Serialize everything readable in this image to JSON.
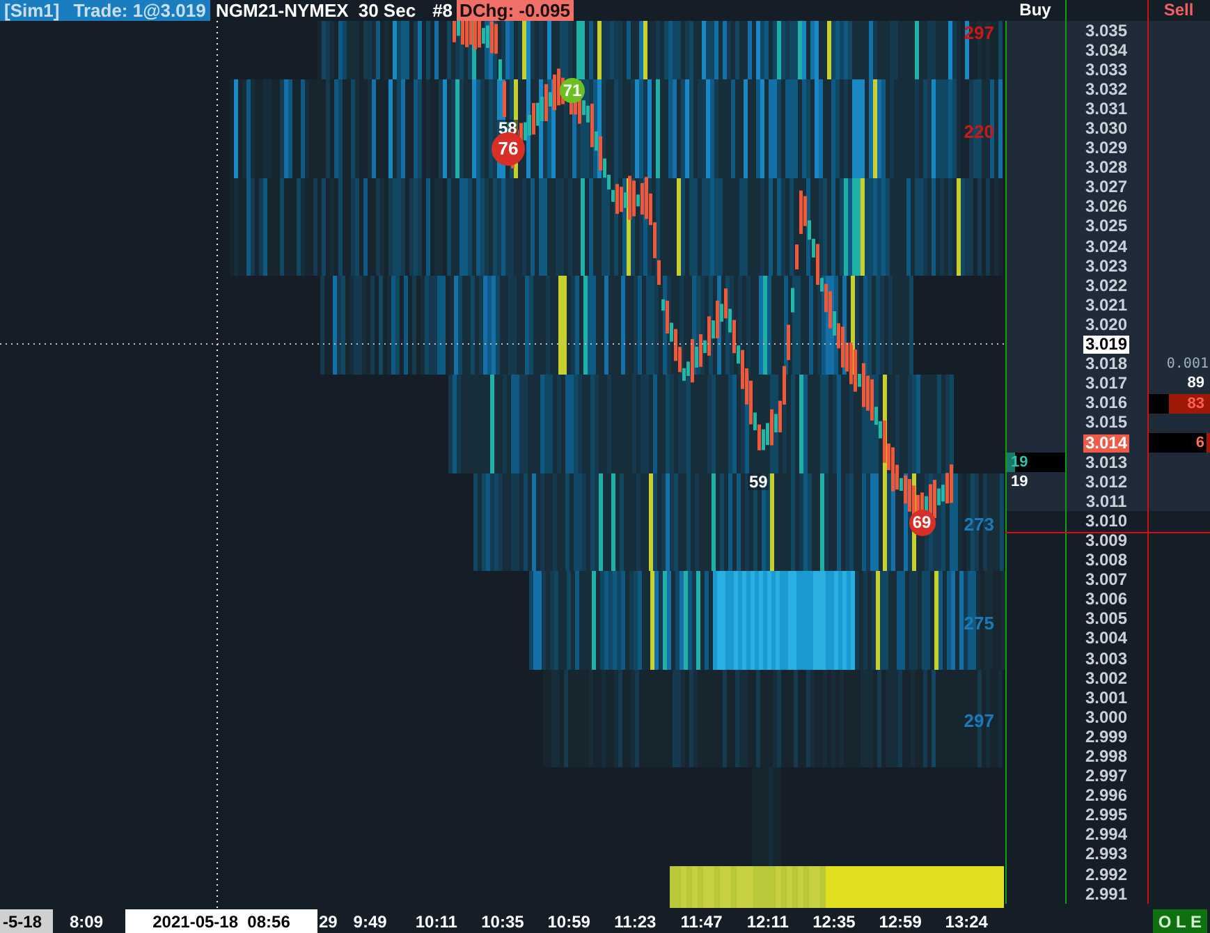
{
  "header": {
    "account": "[Sim1]",
    "trade": "Trade: 1@3.019",
    "instrument": "NGM21-NYMEX",
    "interval": "30 Sec",
    "number": "#8",
    "daily_change": "DChg: -0.095"
  },
  "chart": {
    "band_labels": [
      {
        "text": "297",
        "kind": "ask"
      },
      {
        "text": "220",
        "kind": "ask"
      },
      {
        "text": "273",
        "kind": "bid"
      },
      {
        "text": "275",
        "kind": "bid"
      },
      {
        "text": "297",
        "kind": "bid"
      }
    ],
    "bubbles": [
      {
        "text": "71",
        "kind": "buy"
      },
      {
        "text": "58",
        "kind": "label"
      },
      {
        "text": "76",
        "kind": "sell"
      },
      {
        "text": "59",
        "kind": "label"
      },
      {
        "text": "69",
        "kind": "sell"
      }
    ]
  },
  "ladder": {
    "buy_header": "Buy",
    "sell_header": "Sell",
    "rows": [
      {
        "price": "3.035"
      },
      {
        "price": "3.034"
      },
      {
        "price": "3.033"
      },
      {
        "price": "3.032"
      },
      {
        "price": "3.031"
      },
      {
        "price": "3.030"
      },
      {
        "price": "3.029"
      },
      {
        "price": "3.028"
      },
      {
        "price": "3.027"
      },
      {
        "price": "3.026"
      },
      {
        "price": "3.025"
      },
      {
        "price": "3.024"
      },
      {
        "price": "3.023"
      },
      {
        "price": "3.022"
      },
      {
        "price": "3.021"
      },
      {
        "price": "3.020"
      },
      {
        "price": "3.019",
        "current": true
      },
      {
        "price": "3.018",
        "sell": {
          "text": "0.001",
          "kind": "dim"
        }
      },
      {
        "price": "3.017",
        "sell": {
          "text": "89",
          "kind": "plain"
        }
      },
      {
        "price": "3.016",
        "sell": {
          "text": "83",
          "kind": "bar"
        }
      },
      {
        "price": "3.015"
      },
      {
        "price": "3.014",
        "last_trade": true,
        "sell": {
          "text": "6",
          "kind": "small-bar"
        }
      },
      {
        "price": "3.013",
        "buy": {
          "text": "19",
          "kind": "bar"
        }
      },
      {
        "price": "3.012",
        "buy": {
          "text": "19",
          "kind": "plain"
        }
      },
      {
        "price": "3.011"
      },
      {
        "price": "3.010"
      },
      {
        "price": "3.009"
      },
      {
        "price": "3.008"
      },
      {
        "price": "3.007"
      },
      {
        "price": "3.006"
      },
      {
        "price": "3.005"
      },
      {
        "price": "3.004"
      },
      {
        "price": "3.003"
      },
      {
        "price": "3.002"
      },
      {
        "price": "3.001"
      },
      {
        "price": "3.000"
      },
      {
        "price": "2.999"
      },
      {
        "price": "2.998"
      },
      {
        "price": "2.997"
      },
      {
        "price": "2.996"
      },
      {
        "price": "2.995"
      },
      {
        "price": "2.994"
      },
      {
        "price": "2.993"
      },
      {
        "price": "2.992"
      },
      {
        "price": "2.991"
      }
    ]
  },
  "time_axis": [
    {
      "text": "-5-18",
      "kind": "stub"
    },
    {
      "text": "8:09",
      "kind": "first"
    },
    {
      "text": "2021-05-18  08:56",
      "kind": "cursor"
    },
    {
      "text": "29",
      "kind": "partial"
    },
    {
      "text": "9:49",
      "kind": "tick"
    },
    {
      "text": "10:11",
      "kind": "tick"
    },
    {
      "text": "10:35",
      "kind": "tick"
    },
    {
      "text": "10:59",
      "kind": "tick"
    },
    {
      "text": "11:23",
      "kind": "tick"
    },
    {
      "text": "11:47",
      "kind": "tick"
    },
    {
      "text": "12:11",
      "kind": "tick"
    },
    {
      "text": "12:35",
      "kind": "tick"
    },
    {
      "text": "12:59",
      "kind": "tick"
    },
    {
      "text": "13:24",
      "kind": "tick"
    }
  ],
  "status": "O L E"
}
